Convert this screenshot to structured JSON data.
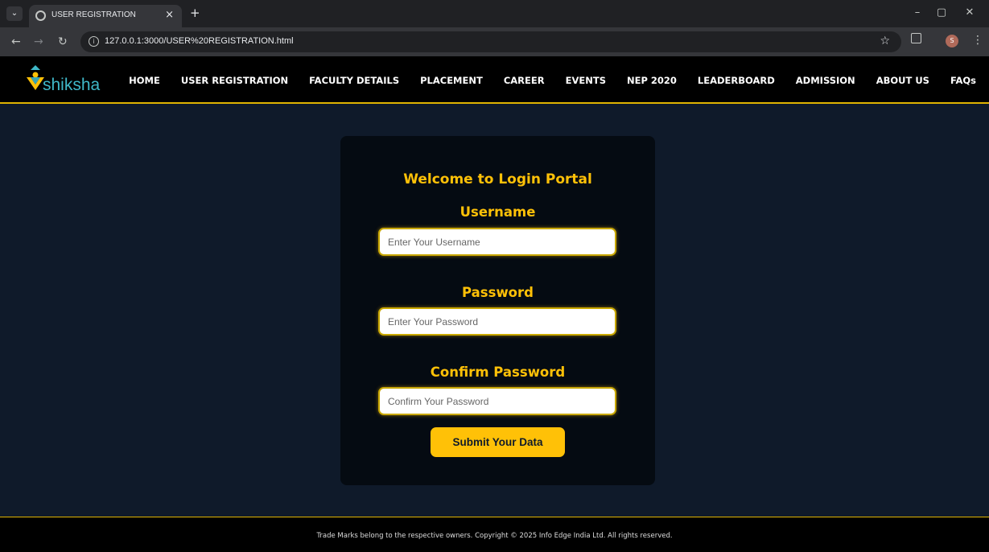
{
  "browser": {
    "tab_title": "USER REGISTRATION",
    "url": "127.0.0.1:3000/USER%20REGISTRATION.html",
    "profile_initial": "S"
  },
  "header": {
    "logo_text": "shiksha",
    "nav": [
      "HOME",
      "USER REGISTRATION",
      "FACULTY DETAILS",
      "PLACEMENT",
      "CAREER",
      "EVENTS",
      "NEP 2020",
      "LEADERBOARD",
      "ADMISSION",
      "ABOUT US",
      "FAQs"
    ]
  },
  "form": {
    "title": "Welcome to Login Portal",
    "username_label": "Username",
    "username_placeholder": "Enter Your Username",
    "password_label": "Password",
    "password_placeholder": "Enter Your Password",
    "confirm_label": "Confirm Password",
    "confirm_placeholder": "Confirm Your Password",
    "submit_label": "Submit Your Data"
  },
  "footer": {
    "text": "Trade Marks belong to the respective owners. Copyright © 2025 Info Edge India Ltd. All rights reserved."
  },
  "colors": {
    "accent": "#ffc107",
    "page_bg": "#0f1a2a",
    "card_bg": "#050b12",
    "logo": "#3fb8c8"
  }
}
